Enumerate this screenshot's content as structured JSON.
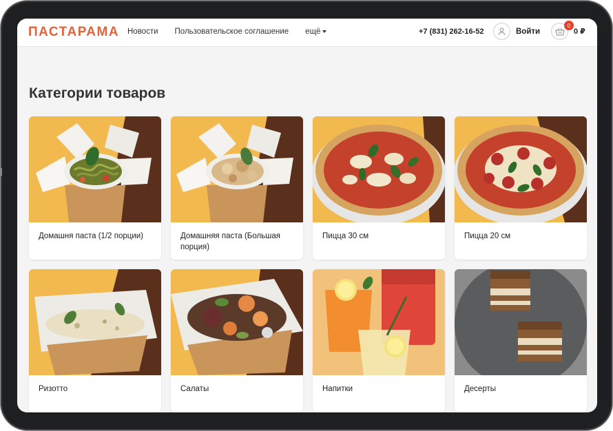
{
  "brand": {
    "logo": "ПАСТАРАМА",
    "accent": "#e0643d"
  },
  "nav": {
    "news": "Новости",
    "agreement": "Пользовательское соглашение",
    "more": "ещё"
  },
  "header": {
    "phone": "+7 (831) 262-16-52",
    "login_label": "Войти",
    "cart_count": "0",
    "cart_total": "0 ₽"
  },
  "main": {
    "title": "Категории товаров",
    "categories": [
      {
        "label": "Домашня паста (1/2 порции)",
        "image": "pasta-box-small"
      },
      {
        "label": "Домашняя паста (Большая порция)",
        "image": "pasta-box-large"
      },
      {
        "label": "Пицца 30 см",
        "image": "pizza-margherita"
      },
      {
        "label": "Пицца 20 см",
        "image": "pizza-pepperoni"
      },
      {
        "label": "Ризотто",
        "image": "risotto-box"
      },
      {
        "label": "Салаты",
        "image": "salad-box"
      },
      {
        "label": "Напитки",
        "image": "drinks"
      },
      {
        "label": "Десерты",
        "image": "tiramisu"
      }
    ]
  }
}
